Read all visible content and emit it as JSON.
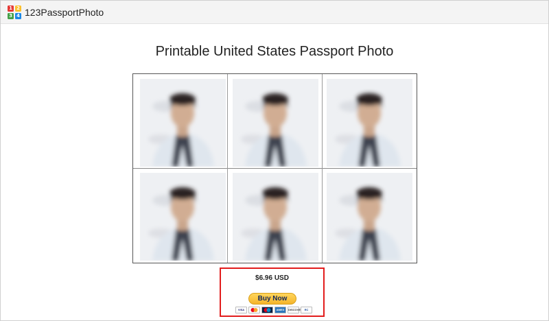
{
  "header": {
    "brand": "123PassportPhoto",
    "logo_digits": [
      "1",
      "2",
      "3",
      "4"
    ],
    "logo_colors": [
      "#e53935",
      "#fbc02d",
      "#43a047",
      "#1e88e5"
    ]
  },
  "page": {
    "title": "Printable United States Passport Photo"
  },
  "print_sheet": {
    "layout": "2 rows x 3 columns",
    "photo_count": 6
  },
  "purchase": {
    "price": "$6.96 USD",
    "buy_label": "Buy Now",
    "highlight_color": "#e21b1b",
    "payment_methods": [
      {
        "name": "VISA",
        "label": "VISA"
      },
      {
        "name": "mastercard",
        "label": ""
      },
      {
        "name": "maestro",
        "label": ""
      },
      {
        "name": "amex",
        "label": "AMEX"
      },
      {
        "name": "discover",
        "label": "DISCOVER"
      },
      {
        "name": "ec-direct",
        "label": "EC"
      }
    ]
  }
}
